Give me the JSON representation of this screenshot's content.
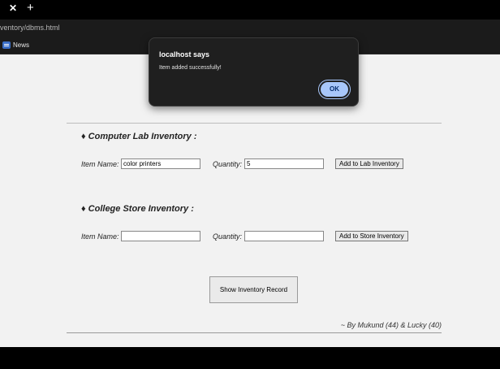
{
  "browser": {
    "tab_close": "✕",
    "tab_new": "+",
    "url": "ventory/dbms.html",
    "bookmark_news": "News"
  },
  "lab_section": {
    "title": "♦ Computer Lab Inventory :",
    "item_label": "Item Name:",
    "item_value": "color printers",
    "qty_label": "Quantity:",
    "qty_value": "5",
    "button": "Add to Lab Inventory"
  },
  "store_section": {
    "title": "♦ College Store Inventory :",
    "item_label": "Item Name:",
    "item_value": "",
    "qty_label": "Quantity:",
    "qty_value": "",
    "button": "Add to Store Inventory"
  },
  "show_button": "Show Inventory Record",
  "credits": "~ By Mukund (44) & Lucky (40)",
  "dialog": {
    "title": "localhost says",
    "message": "Item added successfully!",
    "ok": "OK"
  },
  "colors": {
    "dialog_bg": "#1f1f1f",
    "ok_button": "#a8c7fa",
    "page_bg": "#f2f2f2"
  }
}
